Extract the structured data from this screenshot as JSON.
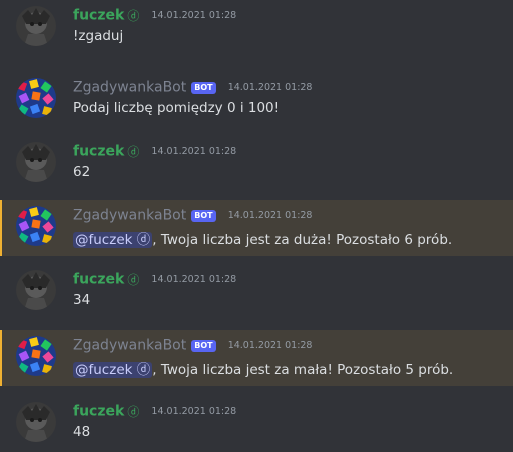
{
  "messages": [
    {
      "author": "fuczek",
      "author_icon": "nitro-badge-icon",
      "is_bot": false,
      "bot_tag": "",
      "timestamp": "14.01.2021 01:28",
      "text": "!zgaduj",
      "mention": "",
      "highlighted": false
    },
    {
      "author": "ZgadywankaBot",
      "is_bot": true,
      "bot_tag": "BOT",
      "timestamp": "14.01.2021 01:28",
      "text": "Podaj liczbę pomiędzy 0 i 100!",
      "mention": "",
      "highlighted": false
    },
    {
      "author": "fuczek",
      "author_icon": "nitro-badge-icon",
      "is_bot": false,
      "bot_tag": "",
      "timestamp": "14.01.2021 01:28",
      "text": "62",
      "mention": "",
      "highlighted": false
    },
    {
      "author": "ZgadywankaBot",
      "is_bot": true,
      "bot_tag": "BOT",
      "timestamp": "14.01.2021 01:28",
      "mention": "@fuczek ",
      "text": ", Twoja liczba jest za duża! Pozostało 6 prób.",
      "highlighted": true
    },
    {
      "author": "fuczek",
      "author_icon": "nitro-badge-icon",
      "is_bot": false,
      "bot_tag": "",
      "timestamp": "14.01.2021 01:28",
      "text": "34",
      "mention": "",
      "highlighted": false
    },
    {
      "author": "ZgadywankaBot",
      "is_bot": true,
      "bot_tag": "BOT",
      "timestamp": "14.01.2021 01:28",
      "mention": "@fuczek ",
      "text": ", Twoja liczba jest za mała! Pozostało 5 prób.",
      "highlighted": true
    },
    {
      "author": "fuczek",
      "author_icon": "nitro-badge-icon",
      "is_bot": false,
      "bot_tag": "",
      "timestamp": "14.01.2021 01:28",
      "text": "48",
      "mention": "",
      "highlighted": false
    }
  ],
  "colors": {
    "background": "#313338",
    "mention_highlight": "#444039",
    "mention_bar": "#f0b132",
    "user_name": "#3ba55c",
    "bot_tag": "#5865f2"
  }
}
